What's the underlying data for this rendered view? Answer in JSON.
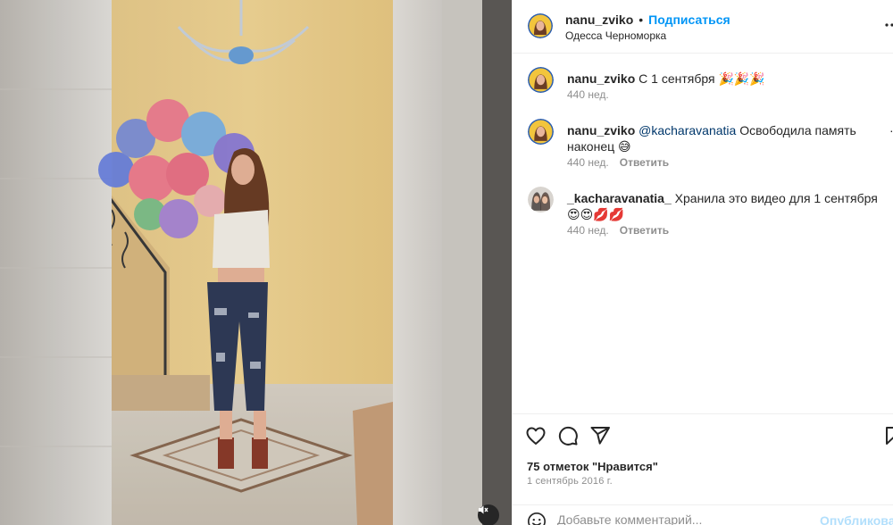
{
  "post": {
    "author": "nanu_zviko",
    "follow_label": "Подписаться",
    "separator": "•",
    "location": "Одесса Черноморка"
  },
  "comments": [
    {
      "user": "nanu_zviko",
      "mention": "",
      "text": "С 1 сентября 🎉🎉🎉",
      "age": "440 нед.",
      "reply_label": ""
    },
    {
      "user": "nanu_zviko",
      "mention": "@kacharavanatia",
      "text": "Освободила память наконец 😅",
      "age": "440 нед.",
      "reply_label": "Ответить"
    },
    {
      "user": "_kacharavanatia_",
      "mention": "",
      "text": "Хранила это видео для 1 сентября 😍😍💋💋",
      "age": "440 нед.",
      "reply_label": "Ответить"
    }
  ],
  "actions": {
    "likes": "75 отметок \"Нравится\"",
    "date": "1 сентябрь 2016 г."
  },
  "add_comment": {
    "placeholder": "Добавьте комментарий...",
    "publish_label": "Опубликовать"
  },
  "icons": {
    "like": "heart-icon",
    "comment": "comment-icon",
    "share": "send-icon",
    "save": "bookmark-icon",
    "emoji": "smiley-icon",
    "mute": "speaker-muted-icon",
    "more": "more-icon"
  },
  "colors": {
    "accent": "#0095f6",
    "muted_text": "#8e8e8e",
    "publish_disabled": "#b2dffc"
  }
}
